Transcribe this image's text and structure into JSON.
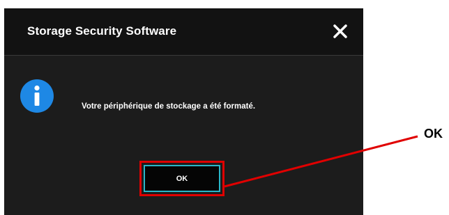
{
  "dialog": {
    "title": "Storage Security Software",
    "close_icon": "close-icon",
    "info_icon": "info-icon",
    "message": "Votre périphérique de stockage a été formaté.",
    "ok_label": "OK"
  },
  "annotation": {
    "label": "OK",
    "highlight_color": "#e00000"
  },
  "colors": {
    "dialog_background": "#1c1c1c",
    "titlebar_background": "#121212",
    "info_icon": "#1e88e5",
    "button_border": "#29b6c8"
  }
}
